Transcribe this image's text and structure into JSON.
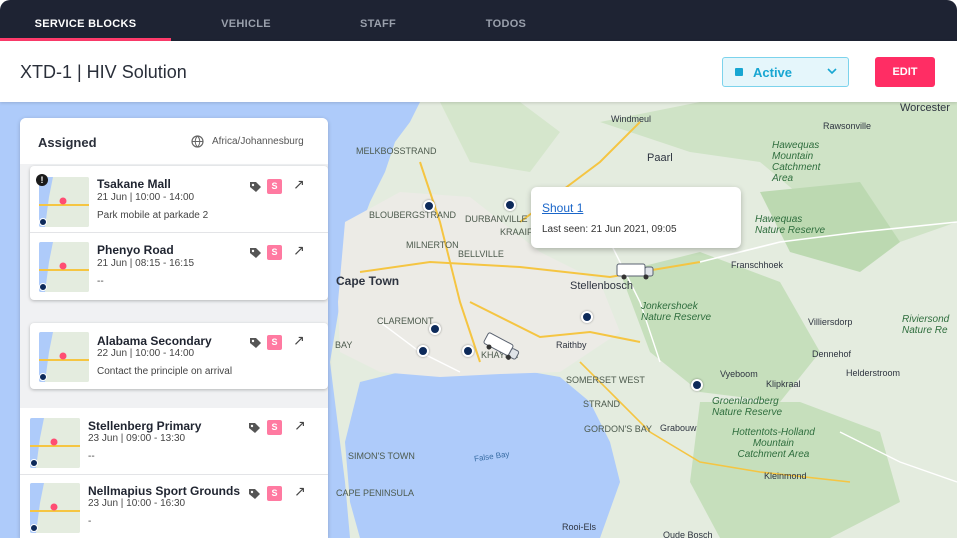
{
  "nav": {
    "tabs": [
      {
        "label": "SERVICE BLOCKS",
        "active": true
      },
      {
        "label": "VEHICLE",
        "active": false
      },
      {
        "label": "STAFF",
        "active": false
      },
      {
        "label": "TODOS",
        "active": false
      }
    ]
  },
  "header": {
    "title": "XTD-1 | HIV Solution",
    "status": "Active",
    "edit_label": "EDIT"
  },
  "panel": {
    "title": "Assigned",
    "timezone": "Africa/Johannesburg",
    "items": [
      {
        "name": "Tsakane Mall",
        "time": "21 Jun  |  10:00 - 14:00",
        "note": "Park mobile at parkade 2",
        "badge": "S",
        "warning": "!"
      },
      {
        "name": "Phenyo Road",
        "time": "21 Jun  |  08:15 - 16:15",
        "note": "--",
        "badge": "S"
      },
      {
        "name": "Alabama Secondary",
        "time": "22 Jun  |  10:00 - 14:00",
        "note": "Contact the principle on arrival",
        "badge": "S"
      },
      {
        "name": "Stellenberg Primary",
        "time": "23 Jun  |  09:00 - 13:30",
        "note": "--",
        "badge": "S"
      },
      {
        "name": "Nellmapius Sport Grounds",
        "time": "23 Jun  |  10:00 - 16:30",
        "note": "-",
        "badge": "S"
      }
    ]
  },
  "popup": {
    "title": "Shout 1",
    "last_seen": "Last seen: 21 Jun 2021, 09:05"
  },
  "map": {
    "labels": {
      "cape_town": "Cape Town",
      "stellenbosch": "Stellenbosch",
      "paarl": "Paarl",
      "worcester": "Worcester",
      "bellville": "BELLVILLE",
      "durbanville": "DURBANVILLE",
      "milnerton": "MILNERTON",
      "blouberg": "BLOUBERGSTRAND",
      "melkbos": "MELKBOSSTRAND",
      "claremont": "CLAREMONT",
      "khayelitsha": "KHAYELI",
      "kraaifontein": "KRAAIFO",
      "somerset": "SOMERSET WEST",
      "strand": "STRAND",
      "gordons": "GORDON'S BAY",
      "simons": "SIMON'S TOWN",
      "false_bay": "False Bay",
      "rawsonville": "Rawsonville",
      "franschhoek": "Franschhoek",
      "villiersdorp": "Villiersdorp",
      "raithby": "Raithby",
      "grabouw": "Grabouw",
      "klipkraal": "Klipkraal",
      "vyeboom": "Vyeboom",
      "helderstroom": "Helderstroom",
      "kleinmond": "Kleinmond",
      "dennehof": "Dennehof",
      "windmeul": "Windmeul",
      "rooi_els": "Rooi-Els",
      "oude_bosch": "Oude Bosch",
      "cape_peninsula": "CAPE PENINSULA",
      "bay": "BAY",
      "hawequas": "Hawequas\nMountain\nCatchment\nArea",
      "hawequas_nr": "Hawequas\nNature Reserve",
      "jonkershoek": "Jonkershoek\nNature Reserve",
      "groenlandberg": "Groenlandberg\nNature Reserve",
      "hottentots": "Hottentots-Holland\nMountain\nCatchment Area",
      "riviersonderend": "Riviersond\nNature Re"
    }
  },
  "colors": {
    "nav_bg": "#1e2333",
    "accent": "#ff2d64",
    "status": "#17a6d2",
    "pin": "#0d2a5a",
    "badge": "#ff7aa1"
  }
}
